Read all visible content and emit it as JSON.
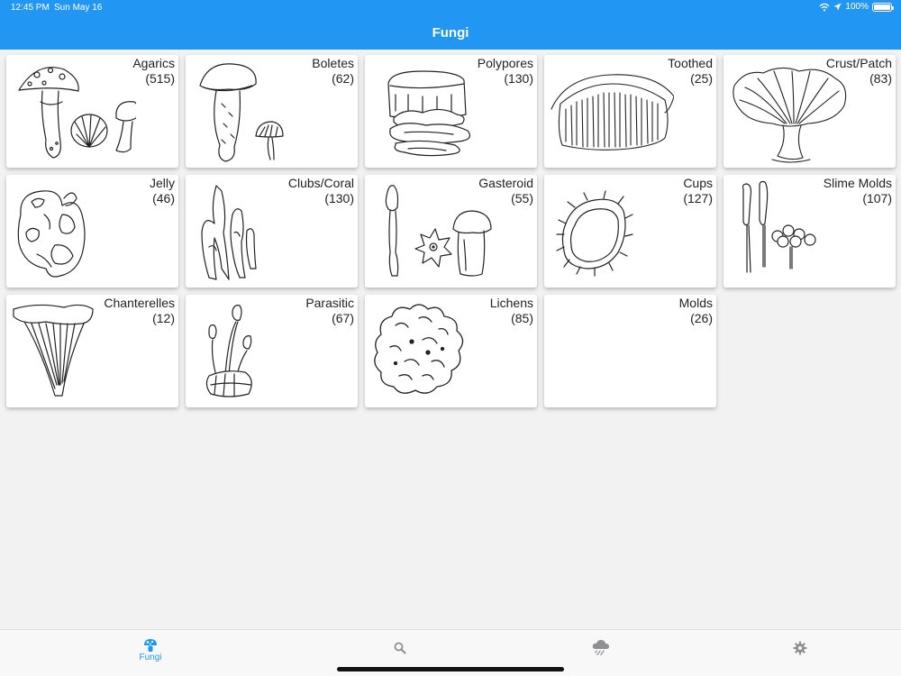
{
  "status_bar": {
    "time": "12:45 PM",
    "date": "Sun May 16",
    "battery": "100%",
    "battery_level": 1.0
  },
  "header": {
    "title": "Fungi"
  },
  "categories": [
    {
      "name": "Agarics",
      "count": "(515)",
      "icon": "agarics-drawing"
    },
    {
      "name": "Boletes",
      "count": "(62)",
      "icon": "boletes-drawing"
    },
    {
      "name": "Polypores",
      "count": "(130)",
      "icon": "polypores-drawing"
    },
    {
      "name": "Toothed",
      "count": "(25)",
      "icon": "toothed-drawing"
    },
    {
      "name": "Crust/Patch",
      "count": "(83)",
      "icon": "crust-patch-drawing"
    },
    {
      "name": "Jelly",
      "count": "(46)",
      "icon": "jelly-drawing"
    },
    {
      "name": "Clubs/Coral",
      "count": "(130)",
      "icon": "clubs-coral-drawing"
    },
    {
      "name": "Gasteroid",
      "count": "(55)",
      "icon": "gasteroid-drawing"
    },
    {
      "name": "Cups",
      "count": "(127)",
      "icon": "cups-drawing"
    },
    {
      "name": "Slime Molds",
      "count": "(107)",
      "icon": "slime-molds-drawing"
    },
    {
      "name": "Chanterelles",
      "count": "(12)",
      "icon": "chanterelles-drawing"
    },
    {
      "name": "Parasitic",
      "count": "(67)",
      "icon": "parasitic-drawing"
    },
    {
      "name": "Lichens",
      "count": "(85)",
      "icon": "lichens-drawing"
    },
    {
      "name": "Molds",
      "count": "(26)",
      "icon": ""
    }
  ],
  "tab_bar": {
    "tabs": [
      {
        "label": "Fungi",
        "icon": "mushroom-icon",
        "active": true
      },
      {
        "label": "",
        "icon": "search-icon",
        "active": false
      },
      {
        "label": "",
        "icon": "rain-cloud-icon",
        "active": false
      },
      {
        "label": "",
        "icon": "gear-icon",
        "active": false
      }
    ]
  },
  "colors": {
    "accent": "#2196f3",
    "inactive_icon": "#8e8e93",
    "background": "#f2f2f2"
  }
}
